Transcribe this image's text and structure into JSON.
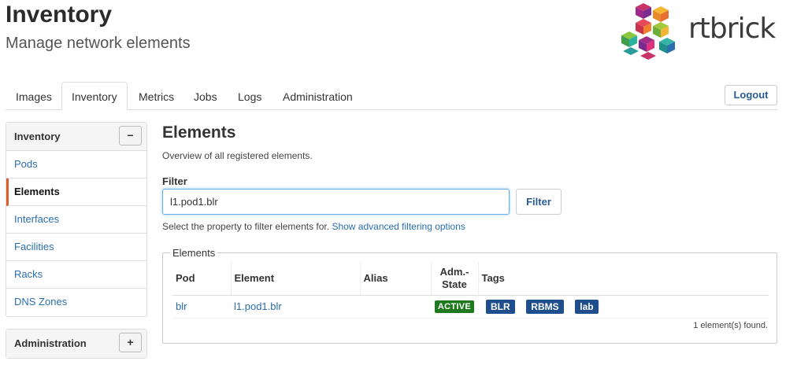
{
  "header": {
    "title": "Inventory",
    "subtitle": "Manage network elements",
    "logo_text": "rtbrick"
  },
  "tabs": [
    {
      "label": "Images",
      "active": false
    },
    {
      "label": "Inventory",
      "active": true
    },
    {
      "label": "Metrics",
      "active": false
    },
    {
      "label": "Jobs",
      "active": false
    },
    {
      "label": "Logs",
      "active": false
    },
    {
      "label": "Administration",
      "active": false
    }
  ],
  "logout_label": "Logout",
  "sidebar": {
    "inventory": {
      "heading": "Inventory",
      "toggle": "−",
      "items": [
        {
          "label": "Pods",
          "active": false
        },
        {
          "label": "Elements",
          "active": true
        },
        {
          "label": "Interfaces",
          "active": false
        },
        {
          "label": "Facilities",
          "active": false
        },
        {
          "label": "Racks",
          "active": false
        },
        {
          "label": "DNS Zones",
          "active": false
        }
      ]
    },
    "administration": {
      "heading": "Administration",
      "toggle": "+"
    }
  },
  "main": {
    "title": "Elements",
    "description": "Overview of all registered elements.",
    "filter": {
      "label": "Filter",
      "value": "l1.pod1.blr",
      "button": "Filter",
      "help_prefix": "Select the property to filter elements for.",
      "help_link": "Show advanced filtering options"
    },
    "elements": {
      "legend": "Elements",
      "columns": [
        "Pod",
        "Element",
        "Alias",
        "Adm.-State",
        "Tags"
      ],
      "rows": [
        {
          "pod": "blr",
          "element": "l1.pod1.blr",
          "alias": "",
          "state": "ACTIVE",
          "tags": [
            "BLR",
            "RBMS",
            "lab"
          ]
        }
      ],
      "count_text": "1 element(s) found."
    }
  },
  "colors": {
    "link": "#2a6ead",
    "active_accent": "#e05a2b",
    "state_active": "#1f7a1f",
    "tag": "#1f4e8c"
  }
}
